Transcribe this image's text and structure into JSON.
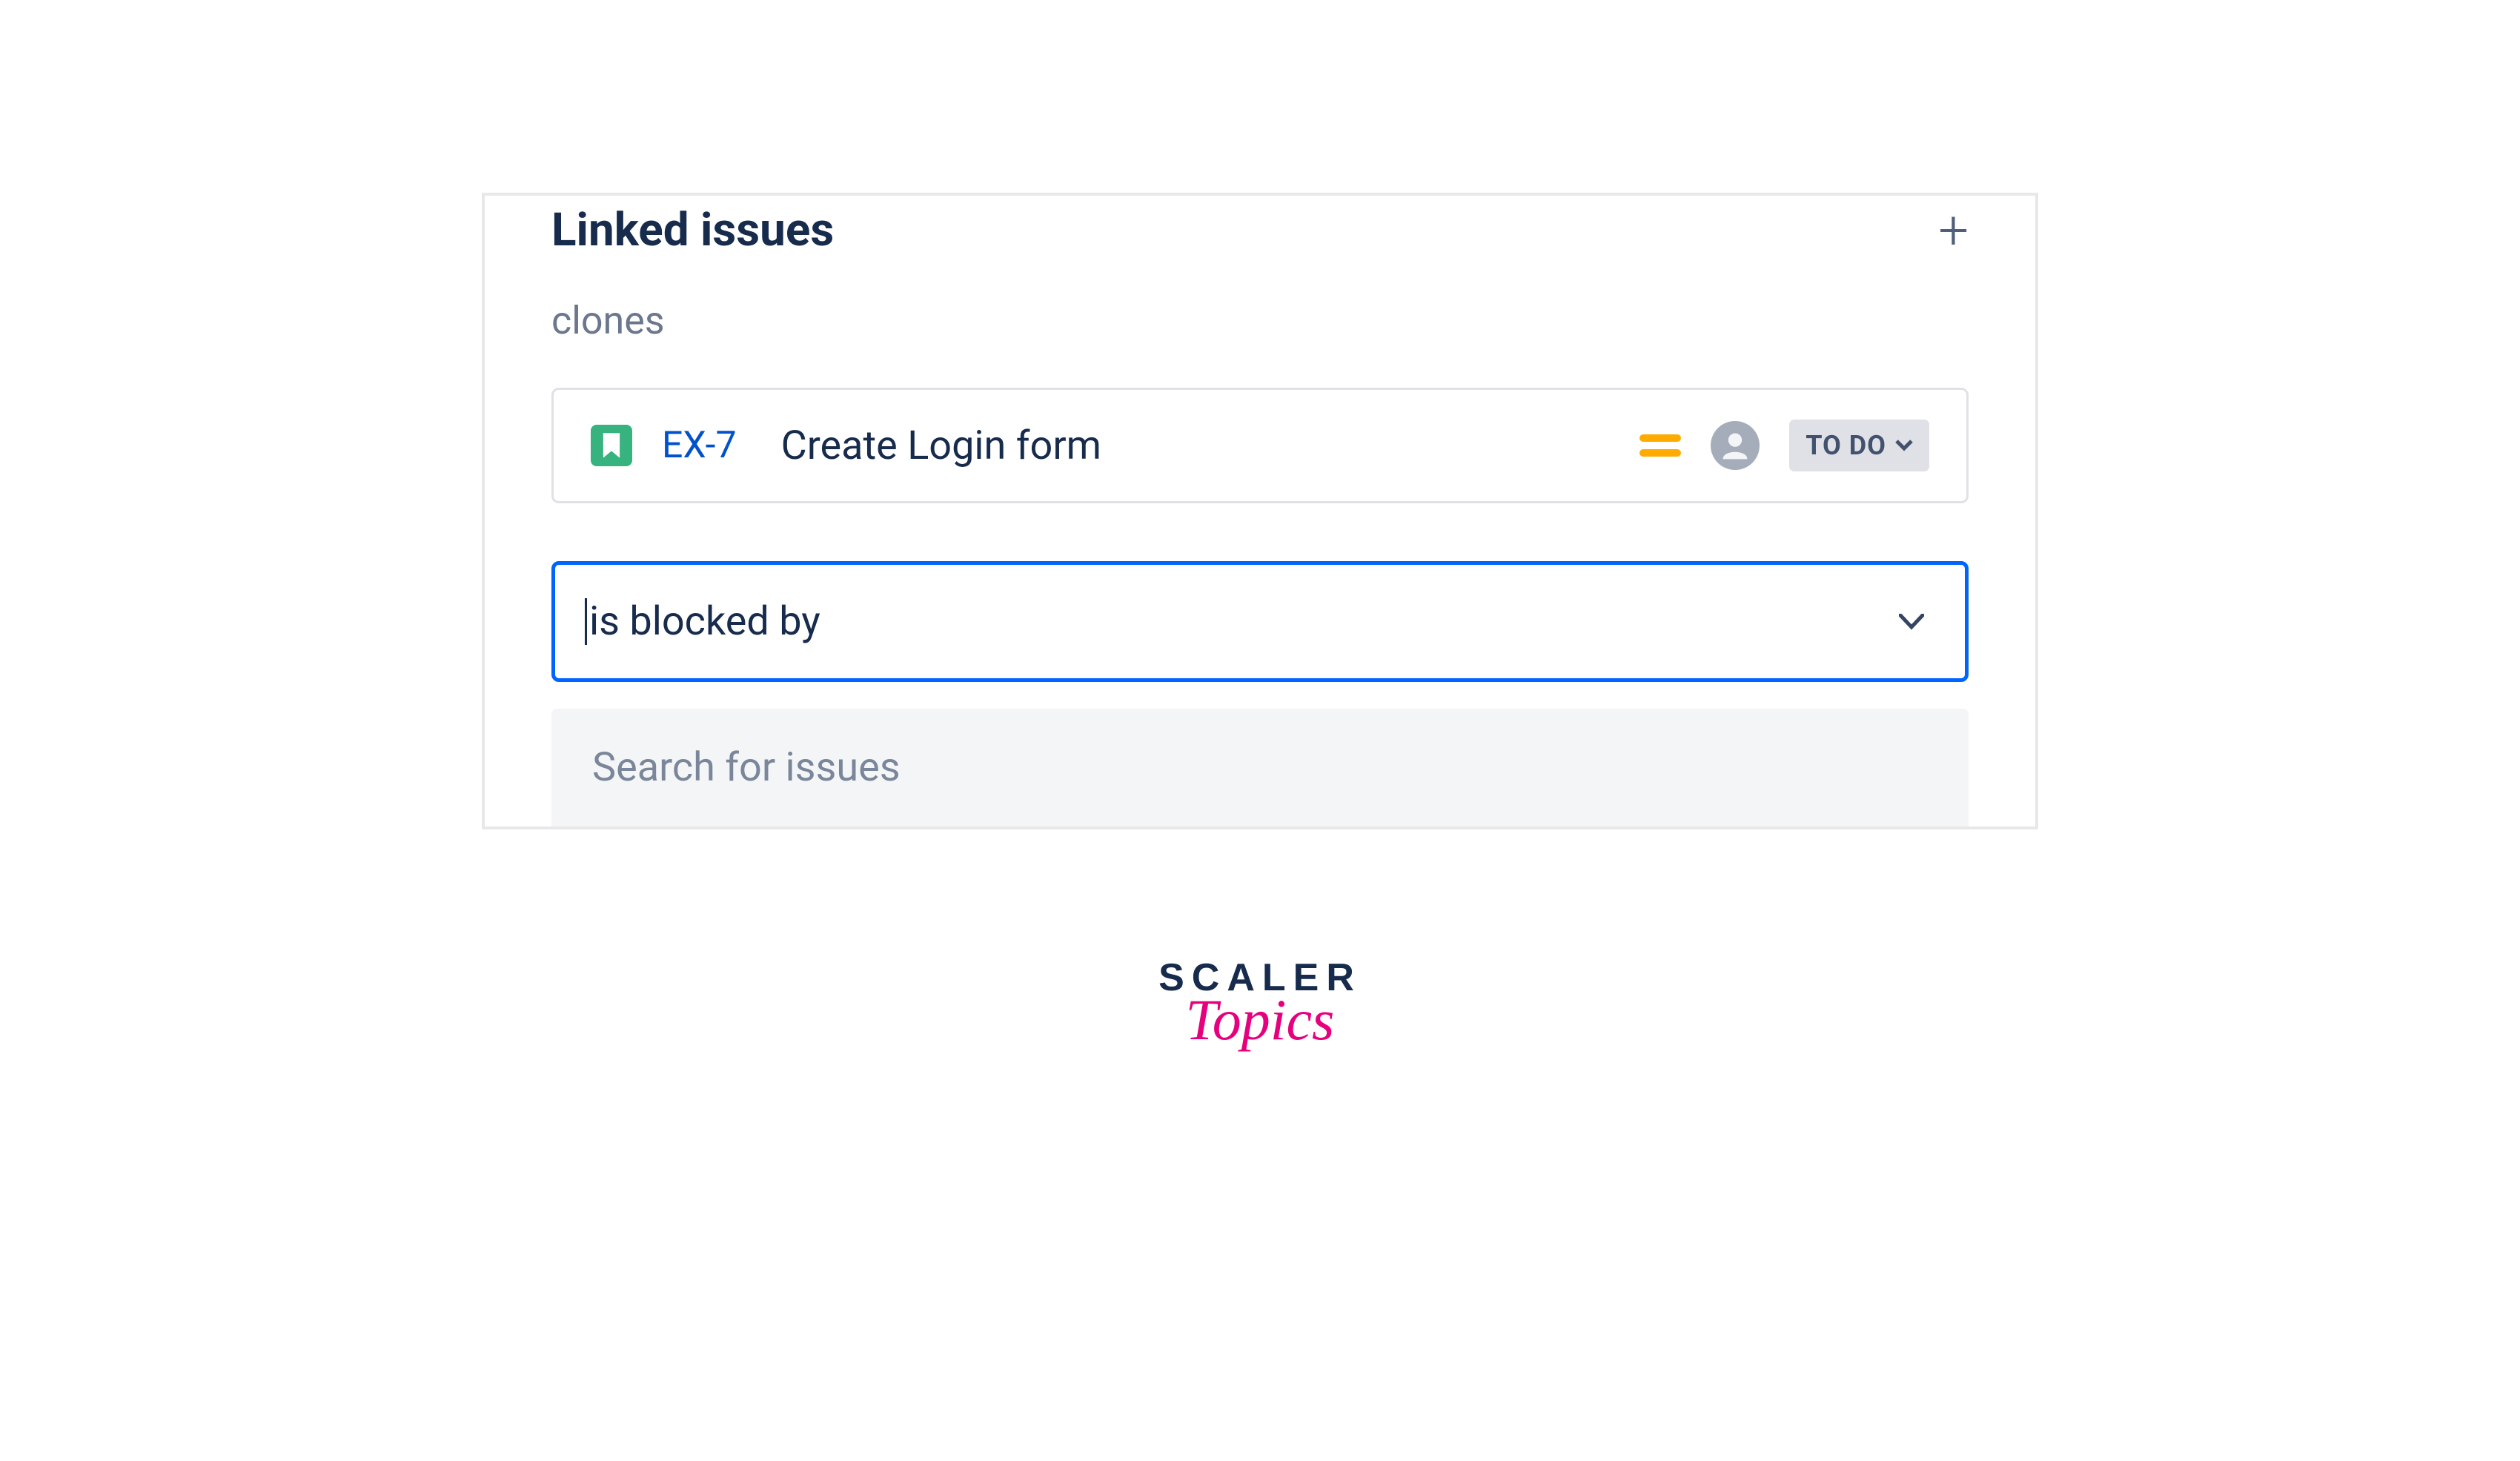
{
  "header": {
    "title": "Linked issues"
  },
  "linkSection": {
    "label": "clones"
  },
  "linkedIssue": {
    "key": "EX-7",
    "summary": "Create Login form",
    "status": "TO DO"
  },
  "linkTypeSelect": {
    "value": "is blocked by"
  },
  "searchInput": {
    "placeholder": "Search for issues"
  },
  "logo": {
    "top": "SCALER",
    "bottom": "Topics"
  }
}
